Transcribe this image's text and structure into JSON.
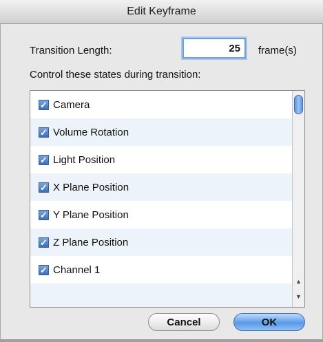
{
  "window": {
    "title": "Edit Keyframe"
  },
  "transition": {
    "length_label": "Transition Length:",
    "length_value": "25",
    "unit_label": "frame(s)"
  },
  "control_label": "Control these states during transition:",
  "states": [
    {
      "label": "Camera",
      "checked": true
    },
    {
      "label": "Volume Rotation",
      "checked": true
    },
    {
      "label": "Light Position",
      "checked": true
    },
    {
      "label": "X Plane Position",
      "checked": true
    },
    {
      "label": "Y Plane Position",
      "checked": true
    },
    {
      "label": "Z Plane Position",
      "checked": true
    },
    {
      "label": "Channel 1",
      "checked": true
    }
  ],
  "buttons": {
    "cancel": "Cancel",
    "ok": "OK"
  },
  "colors": {
    "accent": "#5b9ae6",
    "row_alt": "#edf3fb"
  },
  "icons": {
    "checkbox": "checkmark-icon",
    "scroll_up": "up-arrow-icon",
    "scroll_down": "down-arrow-icon"
  }
}
